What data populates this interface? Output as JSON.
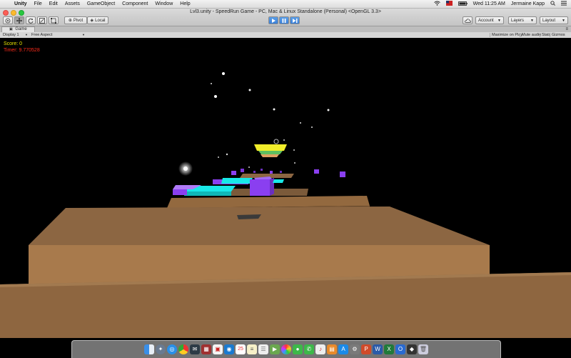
{
  "menubar": {
    "apple_symbol": "",
    "items": [
      "Unity",
      "File",
      "Edit",
      "Assets",
      "GameObject",
      "Component",
      "Window",
      "Help"
    ],
    "datetime": "Wed 11:25 AM",
    "user": "Jermaine Kapp"
  },
  "window": {
    "title": "Lvl3.unity - SpeedRun Game - PC, Mac & Linux Standalone (Personal) <OpenGL 3.3>"
  },
  "toolbar": {
    "pivot_label": "Pivot",
    "local_label": "Local",
    "account_label": "Account",
    "layers_label": "Layers",
    "layout_label": "Layout"
  },
  "game_tab": {
    "tab_label": "Game",
    "display_label": "Display 1",
    "aspect_label": "Free Aspect",
    "maximize_label": "Maximize on Play",
    "mute_label": "Mute audio",
    "stats_label": "Stats",
    "gizmos_label": "Gizmos"
  },
  "hud": {
    "score": "Score: 0",
    "timer": "Timer: 9.770528"
  },
  "colors": {
    "score": "#e8e400",
    "timer": "#ff2a1a",
    "platform": "#8c6642",
    "cyan_block": "#18e8e8",
    "purple_block": "#8a3ff0",
    "goal_yellow": "#f2ee2a"
  },
  "dock": {
    "icons": [
      "finder-icon",
      "launchpad-icon",
      "safari-icon",
      "chrome-icon",
      "mail-icon",
      "photos-icon",
      "calendar-icon",
      "notes-icon",
      "reminders-icon",
      "maps-icon",
      "messages-icon",
      "facetime-icon",
      "itunes-icon",
      "ibooks-icon",
      "appstore-icon",
      "preferences-icon",
      "powerpoint-icon",
      "word-icon",
      "excel-icon",
      "onenote-icon",
      "outlook-icon",
      "unity-icon",
      "monodevelop-icon",
      "downloads-icon",
      "trash-icon"
    ]
  }
}
